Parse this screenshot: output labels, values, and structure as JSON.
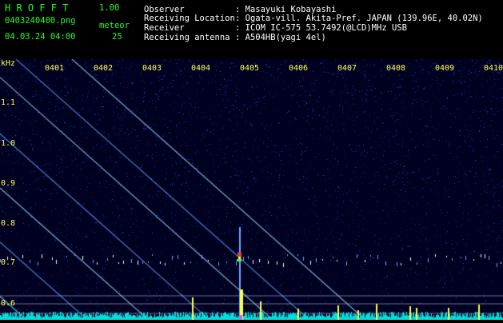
{
  "header": {
    "app_name": "H R O F F T",
    "version": "1.00",
    "filename": "0403240400.png",
    "meteor_label": "meteor",
    "meteor_count": "25",
    "datetime": "04.03.24 04:00",
    "observer_label": "Observer",
    "observer_value": ": Masayuki Kobayashi",
    "location_label": "Receiving Location",
    "location_value": ": Ogata-vill. Akita-Pref. JAPAN (139.96E, 40.02N)",
    "receiver_label": "Receiver",
    "receiver_value": ": ICOM IC-575 53.7492(@LCD)MHz USB",
    "antenna_label": "Receiving antenna",
    "antenna_value": ": A504HB(yagi 4el)"
  },
  "plot": {
    "unit_label": "kHz",
    "y_ticks": [
      "1.1",
      "1.0",
      "0.9",
      "0.8",
      "0.7",
      "0.6"
    ],
    "x_ticks": [
      "0401",
      "0402",
      "0403",
      "0404",
      "0405",
      "0406",
      "0407",
      "0408",
      "0409",
      "0410"
    ],
    "colors": {
      "background": "#000020",
      "axis_text": "#ffff55",
      "noise": "#2244ff",
      "baseline": "#00dddd"
    }
  }
}
